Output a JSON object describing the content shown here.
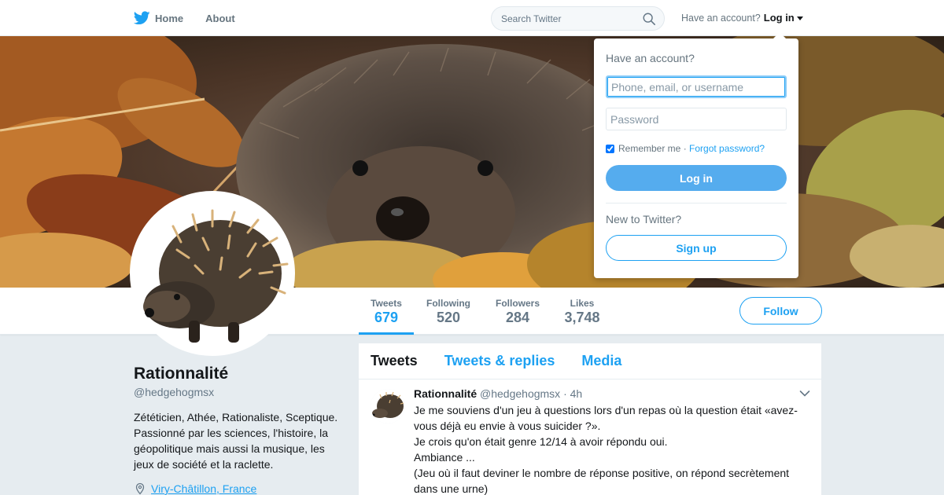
{
  "nav": {
    "home_label": "Home",
    "about_label": "About",
    "search_placeholder": "Search Twitter",
    "account_prompt": "Have an account?",
    "login_label": "Log in"
  },
  "profile": {
    "name": "Rationnalité",
    "handle": "@hedgehogmsx",
    "bio": "Zététicien, Athée, Rationaliste, Sceptique. Passionné par les sciences, l'histoire, la géopolitique mais aussi la musique, les jeux de société et la raclette.",
    "location": "Viry-Châtillon, France",
    "follow_label": "Follow"
  },
  "stats": [
    {
      "label": "Tweets",
      "value": "679"
    },
    {
      "label": "Following",
      "value": "520"
    },
    {
      "label": "Followers",
      "value": "284"
    },
    {
      "label": "Likes",
      "value": "3,748"
    }
  ],
  "timeline": {
    "tabs": [
      "Tweets",
      "Tweets & replies",
      "Media"
    ],
    "tweet": {
      "name": "Rationnalité",
      "handle": "@hedgehogmsx",
      "time": "· 4h",
      "lines": [
        "Je me souviens d'un jeu à questions lors d'un repas où la question était «avez-vous déjà eu envie à vous suicider ?».",
        "Je crois qu'on était genre 12/14 à avoir répondu oui.",
        "Ambiance ...",
        "(Jeu où il faut deviner le nombre de réponse positive, on répond secrètement dans une urne)"
      ]
    }
  },
  "login": {
    "title": "Have an account?",
    "username_placeholder": "Phone, email, or username",
    "password_placeholder": "Password",
    "remember_label": "Remember me ·",
    "forgot_label": "Forgot password?",
    "login_button": "Log in",
    "new_prompt": "New to Twitter?",
    "signup_button": "Sign up"
  },
  "colors": {
    "brand": "#1da1f2",
    "login_button": "#55acee"
  }
}
